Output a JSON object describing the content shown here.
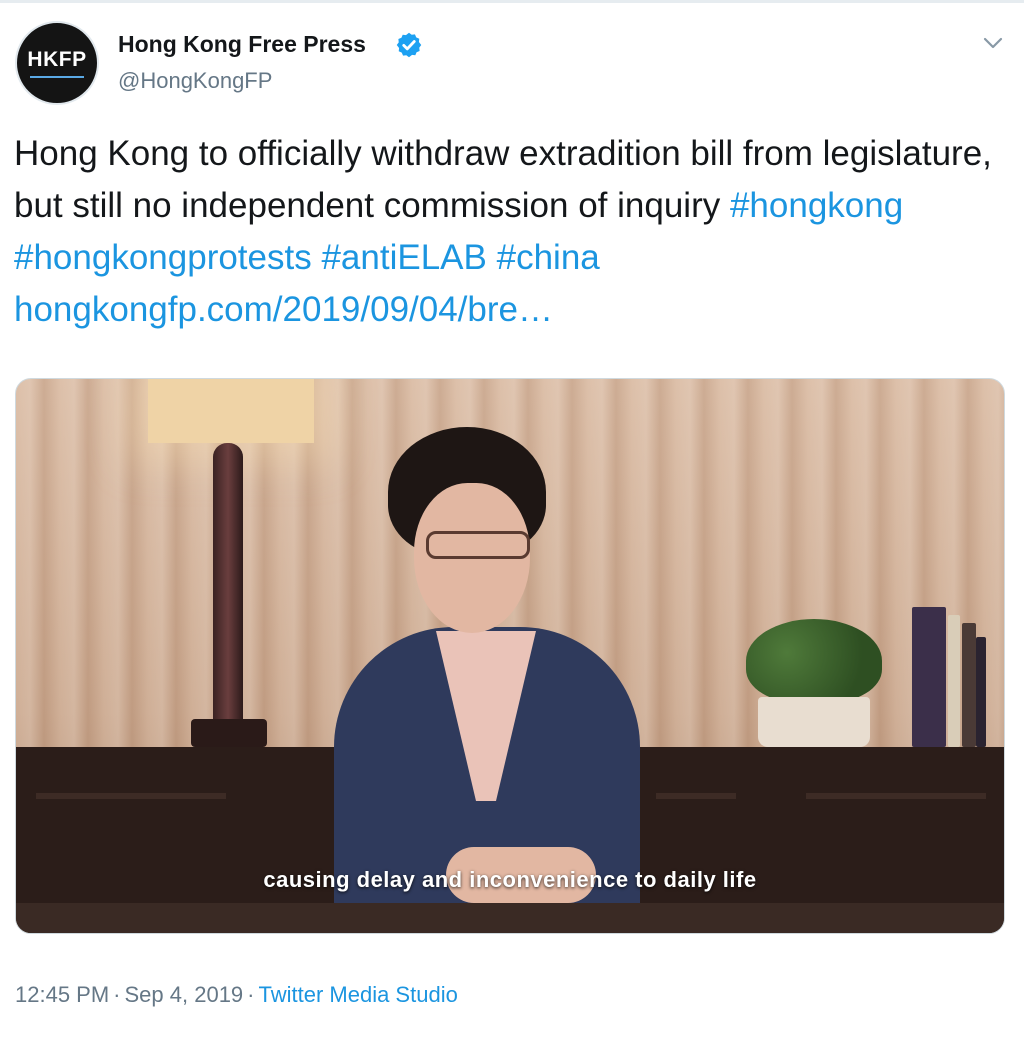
{
  "tweet": {
    "author": {
      "avatar_text": "HKFP",
      "display_name": "Hong Kong Free Press",
      "handle": "@HongKongFP",
      "verified": true
    },
    "text_segments": [
      {
        "type": "text",
        "value": "Hong Kong to officially withdraw extradition bill from legislature, but still no independent commission of inquiry "
      },
      {
        "type": "hashtag",
        "value": "#hongkong"
      },
      {
        "type": "text",
        "value": " "
      },
      {
        "type": "hashtag",
        "value": "#hongkongprotests"
      },
      {
        "type": "text",
        "value": " "
      },
      {
        "type": "hashtag",
        "value": "#antiELAB"
      },
      {
        "type": "text",
        "value": " "
      },
      {
        "type": "hashtag",
        "value": "#china"
      },
      {
        "type": "text",
        "value": " "
      },
      {
        "type": "link",
        "value": "hongkongfp.com/2019/09/04/bre…"
      }
    ],
    "media": {
      "subtitle": "causing delay and inconvenience to daily life"
    },
    "meta": {
      "time": "12:45 PM",
      "separator": "·",
      "date": "Sep 4, 2019",
      "source": "Twitter Media Studio"
    }
  },
  "colors": {
    "link": "#1b95e0",
    "secondary_text": "#657786",
    "primary_text": "#14171a",
    "verified_badge": "#1da1f2"
  },
  "icons": {
    "verified": "verified-badge-icon",
    "caret": "chevron-down-icon"
  }
}
